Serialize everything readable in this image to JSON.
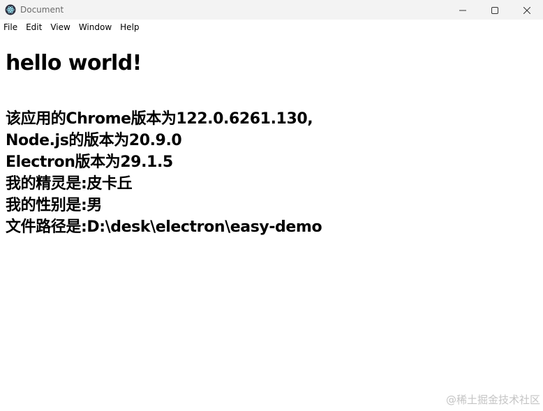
{
  "window": {
    "title": "Document",
    "app_icon": "electron-atom-icon",
    "controls": {
      "minimize_icon": "minimize-icon",
      "maximize_icon": "maximize-icon",
      "close_icon": "close-icon"
    }
  },
  "menu": {
    "items": [
      "File",
      "Edit",
      "View",
      "Window",
      "Help"
    ]
  },
  "content": {
    "heading": "hello world!",
    "lines": [
      "该应用的Chrome版本为122.0.6261.130,",
      "Node.js的版本为20.9.0",
      "Electron版本为29.1.5",
      "我的精灵是:皮卡丘",
      "我的性别是:男",
      "文件路径是:D:\\desk\\electron\\easy-demo"
    ]
  },
  "watermark": "@稀土掘金技术社区",
  "colors": {
    "titlebar_bg": "#f3f3f3",
    "title_text": "#6b6b6b",
    "watermark": "#c4c4c4"
  }
}
